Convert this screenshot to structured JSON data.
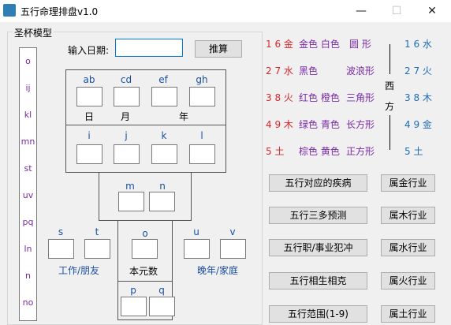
{
  "window": {
    "title": "五行命理排盘v1.0"
  },
  "group": {
    "label": "圣杯模型"
  },
  "vlist": [
    "o",
    "ij",
    "kl",
    "mn",
    "st",
    "uv",
    "pq",
    "ln",
    "n",
    "no"
  ],
  "date": {
    "label": "输入日期:",
    "value": "",
    "button": "推算"
  },
  "top_cells": {
    "ab": "ab",
    "cd": "cd",
    "ef": "ef",
    "gh": "gh",
    "day": "日",
    "month": "月",
    "year": "年"
  },
  "mid_cells": {
    "i": "i",
    "j": "j",
    "k": "k",
    "l": "l"
  },
  "low_cells": {
    "m": "m",
    "n": "n",
    "o": "o",
    "s": "s",
    "t": "t",
    "u": "u",
    "v": "v",
    "p": "p",
    "q": "q",
    "work": "工作/朋友",
    "self": "本元数",
    "late": "晚年/家庭"
  },
  "elements": [
    {
      "left_num": "1 6 金",
      "colors": "金色 白色",
      "shape": "圆 形",
      "right_num": "1 6 水"
    },
    {
      "left_num": "2 7 水",
      "colors": "黑色",
      "shape": "波浪形",
      "right_num": "2 7 火"
    },
    {
      "left_num": "3 8 火",
      "colors": "红色 橙色",
      "shape": "三角形",
      "right_num": "3 8 木"
    },
    {
      "left_num": "4 9 木",
      "colors": "绿色 青色",
      "shape": "长方形",
      "right_num": "4 9 金"
    },
    {
      "left_num": "5   土",
      "colors": "棕色 黄色",
      "shape": "正方形",
      "right_num": "5   土"
    }
  ],
  "west": {
    "top": "西",
    "bottom": "方"
  },
  "buttons_left": [
    "五行对应的疾病",
    "五行三多预测",
    "五行职/事业犯冲",
    "五行相生相克",
    "五行范围(1-9)"
  ],
  "buttons_right": [
    "属金行业",
    "属木行业",
    "属水行业",
    "属火行业",
    "属土行业"
  ]
}
